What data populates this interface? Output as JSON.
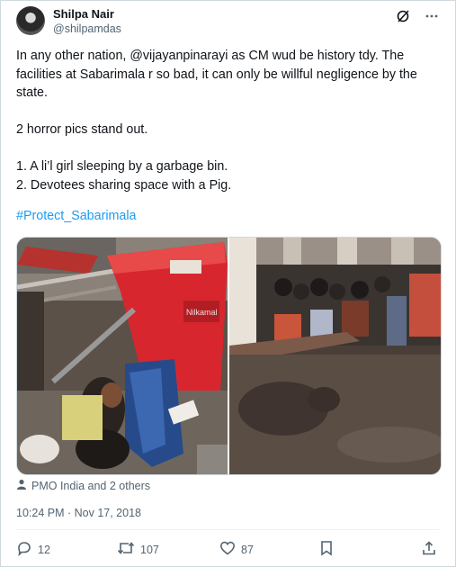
{
  "author": {
    "name": "Shilpa Nair",
    "handle": "@shilpamdas"
  },
  "tweet": {
    "body": "In any other nation, @vijayanpinarayi as CM wud be history tdy. The facilities at Sabarimala r so bad, it can only be willful negligence by the state.\n\n2 horror pics stand out.\n\n1. A li’l girl sleeping by a garbage bin.\n2. Devotees sharing space with a Pig.",
    "hashtag": "#Protect_Sabarimala"
  },
  "media": {
    "bin_brand": "Nilkamal"
  },
  "tagged": {
    "text": "PMO India and 2 others"
  },
  "timestamp": "10:24 PM · Nov 17, 2018",
  "actions": {
    "replies": "12",
    "reposts": "107",
    "likes": "87"
  },
  "icons": [
    "grok-icon",
    "more-icon",
    "person-icon",
    "reply-icon",
    "repost-icon",
    "like-icon",
    "bookmark-icon",
    "share-icon"
  ],
  "colors": {
    "link": "#1d9bf0",
    "muted": "#536471",
    "text": "#0f1419",
    "bin_red": "#d8262e"
  }
}
